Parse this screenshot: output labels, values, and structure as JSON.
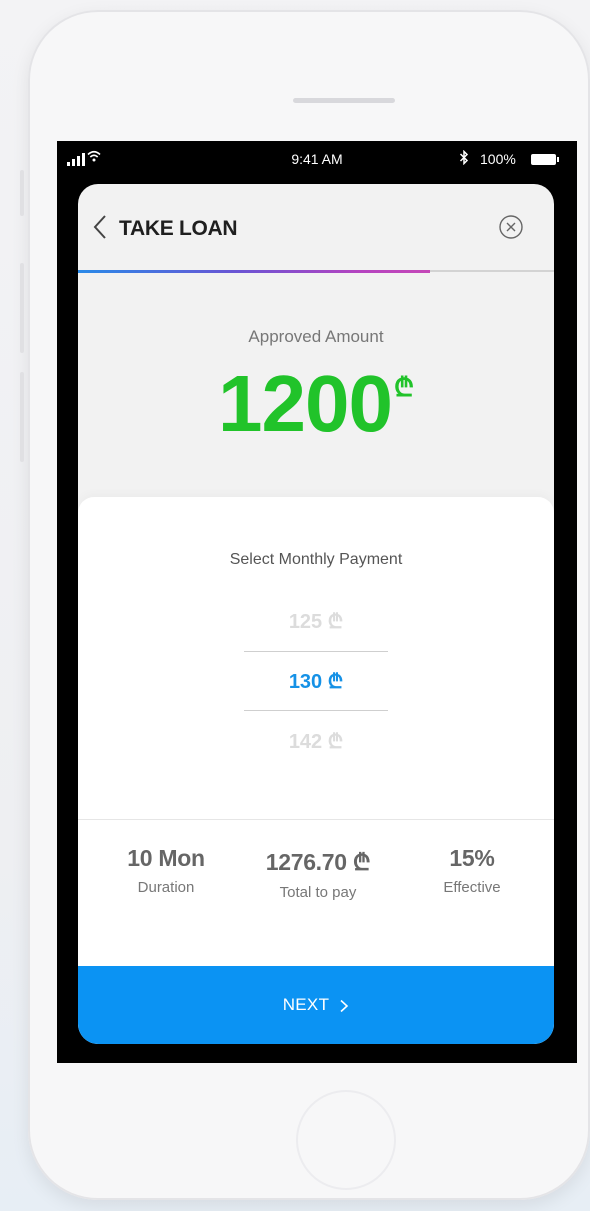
{
  "status_bar": {
    "time": "9:41 AM",
    "battery_percent": "100%",
    "bluetooth_icon": "bluetooth-icon",
    "wifi_icon": "wifi-icon",
    "signal_icon": "cell-signal-icon"
  },
  "header": {
    "title": "TAKE LOAN",
    "back_icon": "chevron-left-icon",
    "close_icon": "close-circle-icon",
    "progress": 0.74,
    "progress_gradient": [
      "#2a8ae8",
      "#6a55d4",
      "#c548b8"
    ]
  },
  "approved": {
    "label": "Approved Amount",
    "amount": "1200",
    "currency": "₾"
  },
  "payment": {
    "label": "Select Monthly Payment",
    "options": [
      "125 ₾",
      "130 ₾",
      "142 ₾"
    ],
    "selected_index": 1
  },
  "summary": [
    {
      "value": "10 Mon",
      "label": "Duration"
    },
    {
      "value": "1276.70 ₾",
      "label": "Total to pay"
    },
    {
      "value": "15%",
      "label": "Effective"
    }
  ],
  "next_button": {
    "label": "NEXT",
    "icon": "chevron-right-icon"
  },
  "colors": {
    "accent_blue": "#0b93f3",
    "amount_green": "#21c32a",
    "selected_blue": "#1591e6"
  }
}
